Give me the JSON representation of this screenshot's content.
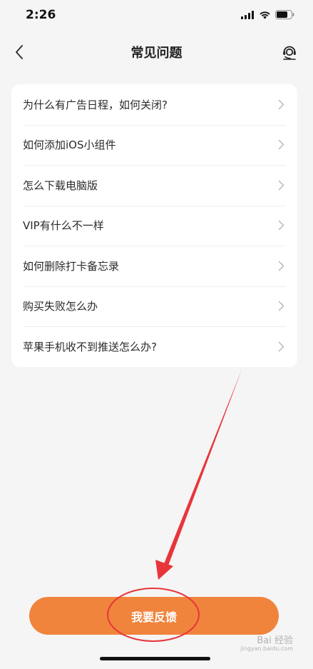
{
  "status_bar": {
    "time": "2:26"
  },
  "nav": {
    "title": "常见问题",
    "back_icon": "chevron-left-icon",
    "support_icon": "customer-service-icon"
  },
  "faq": {
    "items": [
      {
        "label": "为什么有广告日程，如何关闭?"
      },
      {
        "label": "如何添加iOS小组件"
      },
      {
        "label": "怎么下载电脑版"
      },
      {
        "label": "VIP有什么不一样"
      },
      {
        "label": "如何删除打卡备忘录"
      },
      {
        "label": "购买失败怎么办"
      },
      {
        "label": "苹果手机收不到推送怎么办?"
      }
    ]
  },
  "footer": {
    "feedback_label": "我要反馈"
  },
  "watermark": {
    "text": "Bai 经验",
    "url": "jingyan.baidu.com"
  },
  "colors": {
    "accent": "#f0843c",
    "annotation": "#e8353a",
    "background": "#f5f5f5"
  }
}
